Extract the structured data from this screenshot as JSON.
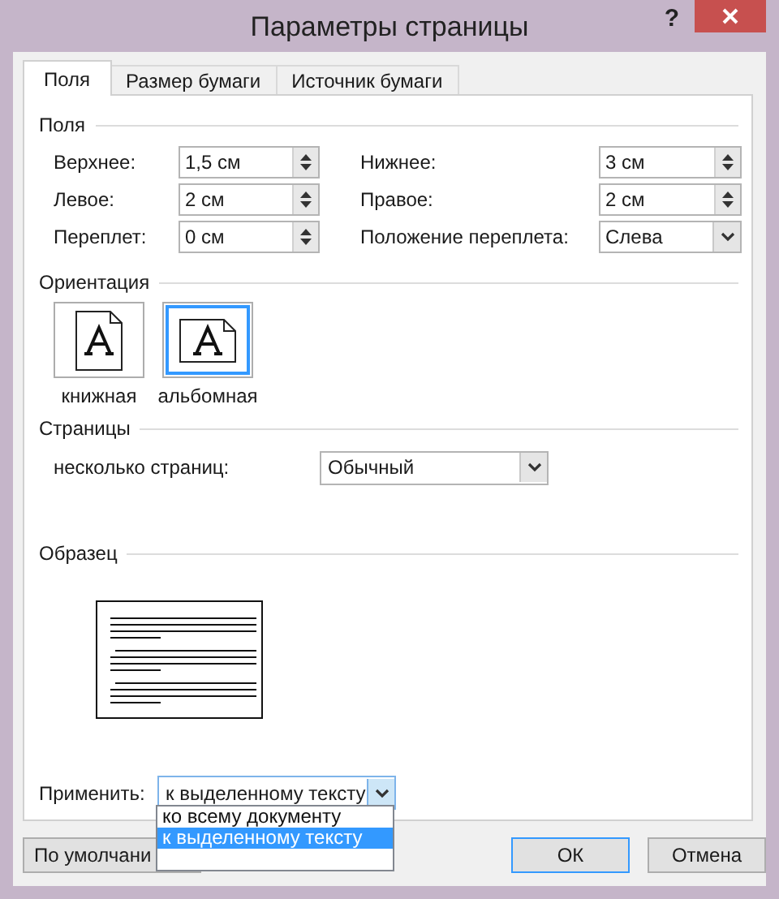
{
  "window": {
    "title": "Параметры страницы",
    "help": "?"
  },
  "tabs": [
    {
      "label": "Поля",
      "selected": true
    },
    {
      "label": "Размер бумаги",
      "selected": false
    },
    {
      "label": "Источник бумаги",
      "selected": false
    }
  ],
  "margins": {
    "heading": "Поля",
    "fields": [
      {
        "label": "Верхнее:",
        "value": "1,5 см",
        "kind": "spin"
      },
      {
        "label": "Нижнее:",
        "value": "3 см",
        "kind": "spin"
      },
      {
        "label": "Левое:",
        "value": "2 см",
        "kind": "spin"
      },
      {
        "label": "Правое:",
        "value": "2 см",
        "kind": "spin"
      },
      {
        "label": "Переплет:",
        "value": "0 см",
        "kind": "spin"
      },
      {
        "label": "Положение переплета:",
        "value": "Слева",
        "kind": "select"
      }
    ]
  },
  "orientation": {
    "heading": "Ориентация",
    "options": [
      {
        "label": "книжная",
        "kind": "portrait",
        "selected": false
      },
      {
        "label": "альбомная",
        "kind": "landscape",
        "selected": true
      }
    ]
  },
  "pages": {
    "heading": "Страницы",
    "label": "несколько страниц:",
    "value": "Обычный"
  },
  "preview": {
    "heading": "Образец"
  },
  "apply": {
    "label": "Применить:",
    "value": "к выделенному тексту",
    "expanded": true,
    "options": [
      {
        "label": "ко всему документу",
        "selected": false
      },
      {
        "label": "к выделенному тексту",
        "selected": true
      }
    ]
  },
  "buttons": [
    {
      "label": "По умолчани",
      "kind": "default"
    },
    {
      "label": "ОК",
      "kind": "primary"
    },
    {
      "label": "Отмена",
      "kind": "normal"
    }
  ]
}
